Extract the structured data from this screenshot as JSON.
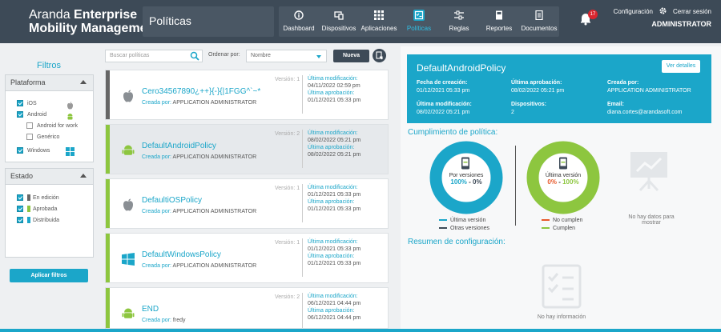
{
  "header": {
    "brand_line1": "Aranda ",
    "brand_line1_bold": "Enterprise",
    "brand_line2": "Mobility Management",
    "section_title": "Políticas",
    "nav": [
      {
        "label": "Dashboard",
        "icon": "info-icon"
      },
      {
        "label": "Dispositivos",
        "icon": "devices-icon"
      },
      {
        "label": "Aplicaciones",
        "icon": "apps-grid-icon"
      },
      {
        "label": "Políticas",
        "icon": "policy-icon"
      },
      {
        "label": "Reglas",
        "icon": "rules-icon"
      },
      {
        "label": "Reportes",
        "icon": "reports-icon"
      },
      {
        "label": "Documentos",
        "icon": "documents-icon"
      }
    ],
    "notifications_count": "17",
    "config_label": "Configuración",
    "logout_label": "Cerrar sesión",
    "username": "ADMINISTRATOR"
  },
  "filters": {
    "title": "Filtros",
    "platform_title": "Plataforma",
    "platform_options": [
      "iOS",
      "Android",
      "Android for work",
      "Genérico",
      "Windows"
    ],
    "state_title": "Estado",
    "state_options": [
      {
        "label": "En edición",
        "color": "#666666"
      },
      {
        "label": "Aprobada",
        "color": "#8dc63f"
      },
      {
        "label": "Distribuida",
        "color": "#1ba6c9"
      }
    ],
    "apply_label": "Aplicar filtros"
  },
  "toolbar": {
    "search_placeholder": "Buscar políticas",
    "sort_label": "Ordenar por:",
    "sort_value": "Nombre",
    "new_label": "Nueva"
  },
  "labels": {
    "version": "Versión:",
    "last_modified": "Última modificación:",
    "last_approval": "Última aprobación:",
    "created_by": "Creada por:"
  },
  "policies": [
    {
      "name": "Cero34567890¿++}{-}{|1FGG^`~*",
      "os": "apple",
      "version": "1",
      "modified": "04/11/2022 02:59 pm",
      "approved": "01/12/2021 05:33 pm",
      "creator": "APPLICATION ADMINISTRATOR",
      "bar_color": "#666666"
    },
    {
      "name": "DefaultAndroidPolicy",
      "os": "android",
      "version": "2",
      "modified": "08/02/2022 05:21 pm",
      "approved": "08/02/2022 05:21 pm",
      "creator": "APPLICATION ADMINISTRATOR",
      "bar_color": "#8dc63f"
    },
    {
      "name": "DefaultiOSPolicy",
      "os": "apple",
      "version": "1",
      "modified": "01/12/2021 05:33 pm",
      "approved": "01/12/2021 05:33 pm",
      "creator": "APPLICATION ADMINISTRATOR",
      "bar_color": "#8dc63f"
    },
    {
      "name": "DefaultWindowsPolicy",
      "os": "windows",
      "version": "1",
      "modified": "01/12/2021 05:33 pm",
      "approved": "01/12/2021 05:33 pm",
      "creator": "APPLICATION ADMINISTRATOR",
      "bar_color": "#8dc63f"
    },
    {
      "name": "END",
      "os": "android",
      "version": "2",
      "modified": "06/12/2021 04:44 pm",
      "approved": "06/12/2021 04:44 pm",
      "creator": "fredy",
      "bar_color": "#8dc63f"
    }
  ],
  "detail": {
    "title": "DefaultAndroidPolicy",
    "details_button": "Ver detalles",
    "fields": [
      {
        "key": "Fecha de creación:",
        "value": "01/12/2021 05:33 pm"
      },
      {
        "key": "Última aprobación:",
        "value": "08/02/2022 05:21 pm"
      },
      {
        "key": "Creada por:",
        "value": "APPLICATION ADMINISTRATOR"
      },
      {
        "key": "Última modificación:",
        "value": "08/02/2022 05:21 pm"
      },
      {
        "key": "Dispositivos:",
        "value": "2"
      },
      {
        "key": "Email:",
        "value": "diana.cortes@arandasoft.com"
      }
    ],
    "compliance_title": "Cumplimiento de política:",
    "donut1": {
      "label": "Por versiones",
      "pct_a": "100%",
      "sep": " - ",
      "pct_b": "0%",
      "legend": [
        "Última versión",
        "Otras versiones"
      ],
      "colors": [
        "#1ba6c9",
        "#3d4a57"
      ]
    },
    "donut2": {
      "label": "Última versión",
      "pct_a": "0%",
      "sep": " - ",
      "pct_b": "100%",
      "legend": [
        "No cumplen",
        "Cumplen"
      ],
      "colors": [
        "#e8592a",
        "#8dc63f"
      ]
    },
    "nodata_chart": "No hay datos para mostrar",
    "config_title": "Resumen de configuración:",
    "nodata_info": "No hay información"
  }
}
